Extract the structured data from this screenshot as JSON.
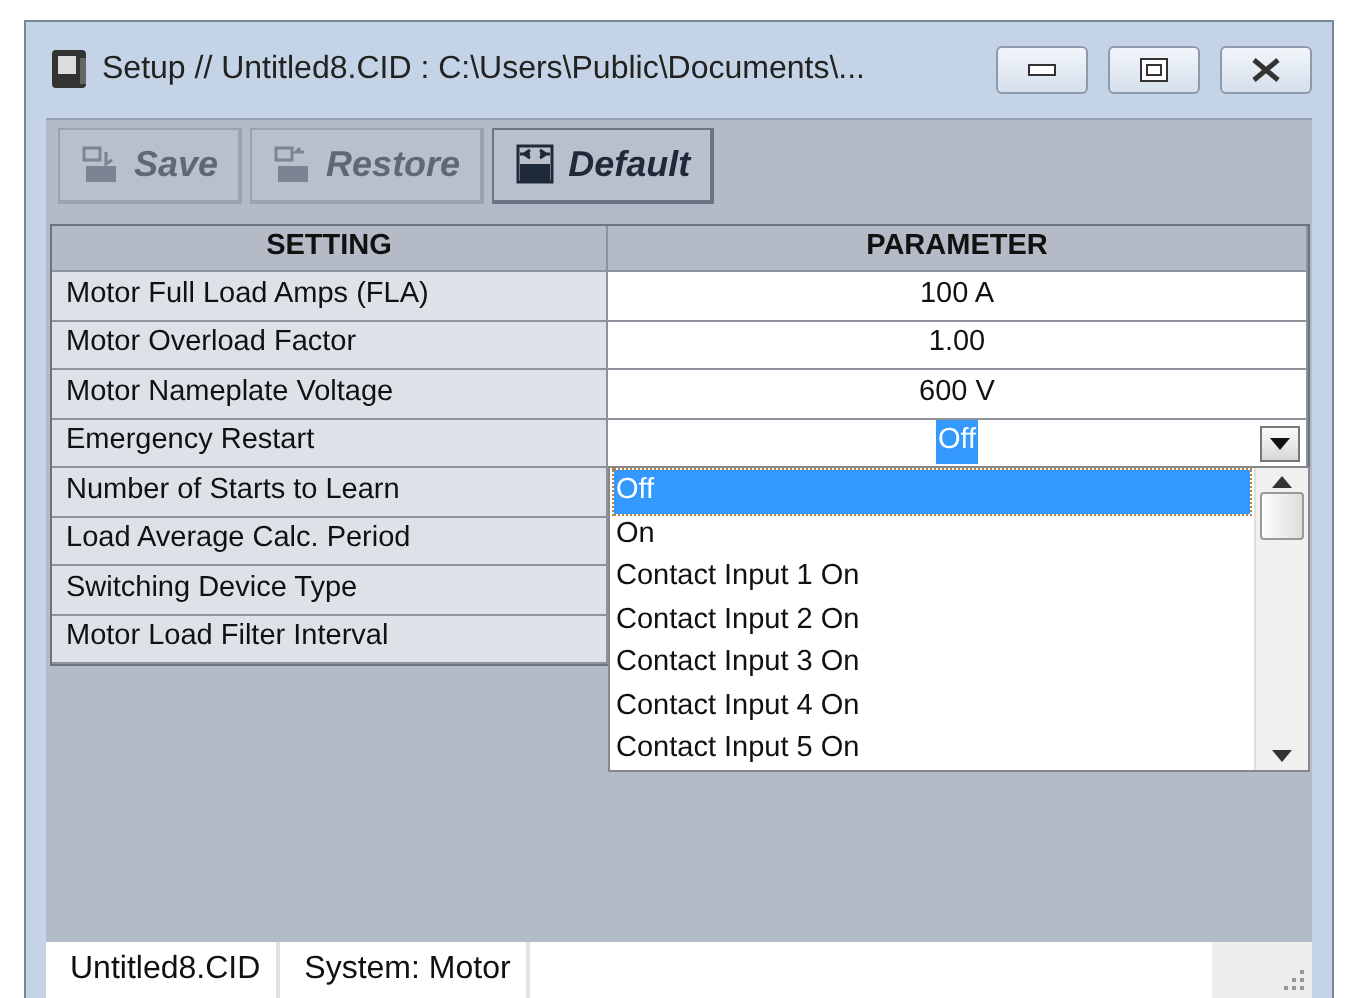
{
  "window": {
    "title": "Setup // Untitled8.CID : C:\\Users\\Public\\Documents\\..."
  },
  "toolbar": [
    {
      "label": "Save",
      "kind": "save",
      "disabled": true
    },
    {
      "label": "Restore",
      "kind": "restore",
      "disabled": true
    },
    {
      "label": "Default",
      "kind": "default",
      "disabled": false
    }
  ],
  "table": {
    "columns": [
      "SETTING",
      "PARAMETER"
    ],
    "rows": [
      {
        "setting": "Motor Full Load Amps (FLA)",
        "parameter": "100 A",
        "kind": "value"
      },
      {
        "setting": "Motor Overload Factor",
        "parameter": "1.00",
        "kind": "value"
      },
      {
        "setting": "Motor Nameplate Voltage",
        "parameter": "600 V",
        "kind": "value"
      },
      {
        "setting": "Emergency Restart",
        "parameter": "Off",
        "kind": "dropdown",
        "expanded": true
      },
      {
        "setting": "Number of Starts to Learn",
        "kind": "covered"
      },
      {
        "setting": "Load Average Calc. Period",
        "kind": "covered"
      },
      {
        "setting": "Switching Device Type",
        "kind": "covered"
      },
      {
        "setting": "Motor Load Filter Interval",
        "kind": "covered"
      }
    ]
  },
  "dropdown_options": [
    {
      "label": "Off",
      "selected": true
    },
    {
      "label": "On",
      "selected": false
    },
    {
      "label": "Contact Input 1 On",
      "selected": false
    },
    {
      "label": "Contact Input 2 On",
      "selected": false
    },
    {
      "label": "Contact Input 3 On",
      "selected": false
    },
    {
      "label": "Contact Input 4 On",
      "selected": false
    },
    {
      "label": "Contact Input 5 On",
      "selected": false
    }
  ],
  "status_bar": [
    "Untitled8.CID",
    "System: Motor"
  ]
}
